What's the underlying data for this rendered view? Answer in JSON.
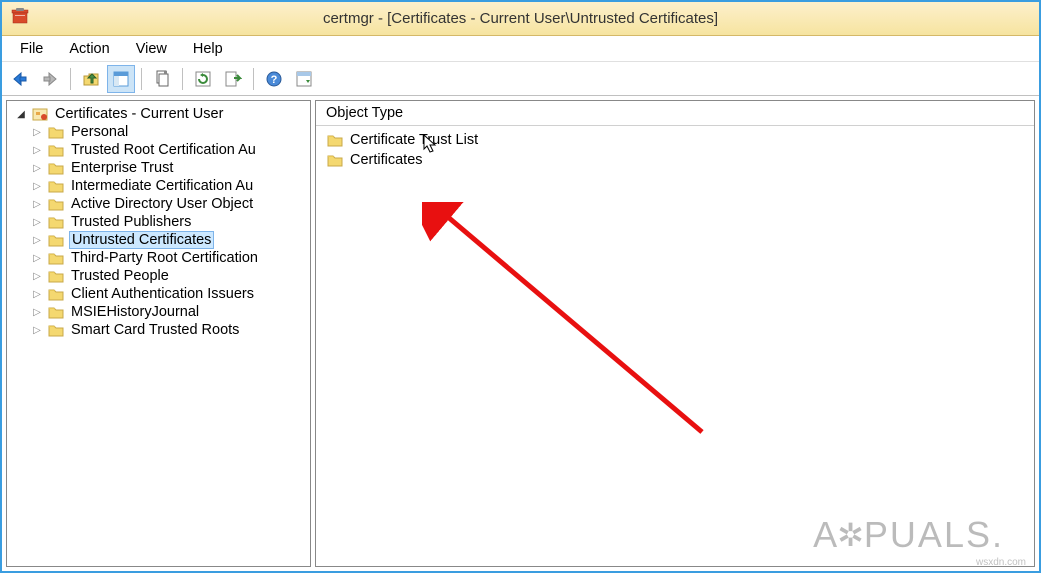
{
  "window": {
    "title": "certmgr - [Certificates - Current User\\Untrusted Certificates]"
  },
  "menu": {
    "file": "File",
    "action": "Action",
    "view": "View",
    "help": "Help"
  },
  "tree": {
    "root": "Certificates - Current User",
    "items": [
      "Personal",
      "Trusted Root Certification Au",
      "Enterprise Trust",
      "Intermediate Certification Au",
      "Active Directory User Object",
      "Trusted Publishers",
      "Untrusted Certificates",
      "Third-Party Root Certification",
      "Trusted People",
      "Client Authentication Issuers",
      "MSIEHistoryJournal",
      "Smart Card Trusted Roots"
    ],
    "selected_index": 6
  },
  "list": {
    "header": "Object Type",
    "rows": [
      "Certificate Trust List",
      "Certificates"
    ]
  },
  "watermark": {
    "prefix": "A",
    "middle": "PUALS",
    "suffix": ".",
    "small": "wsxdn.com"
  }
}
